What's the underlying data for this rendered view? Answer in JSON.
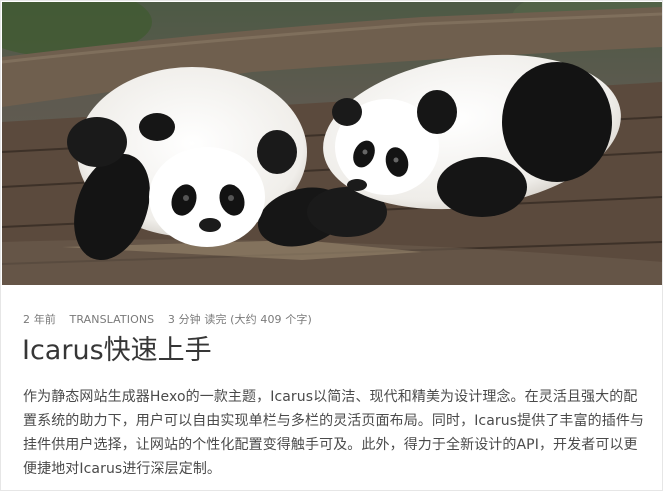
{
  "post": {
    "cover_alt": "panda-cubs-cover-photo",
    "meta": {
      "date": "2 年前",
      "category": "TRANSLATIONS",
      "read_time": "3 分钟 读完 (大约 409 个字)"
    },
    "title": "Icarus快速上手",
    "excerpt": "作为静态网站生成器Hexo的一款主题，Icarus以简洁、现代和精美为设计理念。在灵活且强大的配置系统的助力下，用户可以自由实现单栏与多栏的灵活页面布局。同时，Icarus提供了丰富的插件与挂件供用户选择，让网站的个性化配置变得触手可及。此外，得力于全新设计的API，开发者可以更便捷地对Icarus进行深层定制。"
  },
  "colors": {
    "card_bg": "#ffffff",
    "title": "#363636",
    "text": "#4a4a4a",
    "meta": "#7a7a7a"
  }
}
